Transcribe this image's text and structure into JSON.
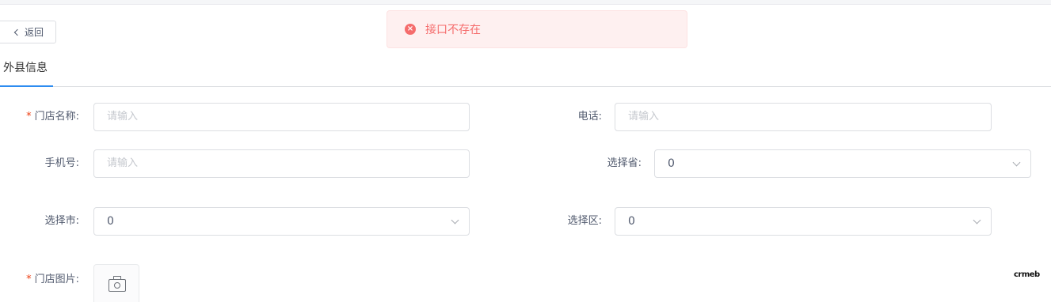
{
  "header": {
    "back_label": "返回"
  },
  "toast": {
    "message": "接口不存在",
    "type": "error"
  },
  "tabs": [
    {
      "label": "外县信息",
      "active": true
    }
  ],
  "form": {
    "store_name": {
      "label": "门店名称:",
      "required": true,
      "placeholder": "请输入"
    },
    "phone": {
      "label": "电话:",
      "placeholder": "请输入"
    },
    "mobile": {
      "label": "手机号:",
      "placeholder": "请输入"
    },
    "province": {
      "label": "选择省:",
      "value": "0"
    },
    "city": {
      "label": "选择市:",
      "value": "0"
    },
    "district": {
      "label": "选择区:",
      "value": "0"
    },
    "store_image": {
      "label": "门店图片:",
      "required": true
    }
  },
  "watermark": "crmeb",
  "colors": {
    "error": "#f56c6c",
    "error_bg": "#fef0f0",
    "required": "#ed4014",
    "accent": "#2d8cf0",
    "border": "#dcdee2"
  }
}
